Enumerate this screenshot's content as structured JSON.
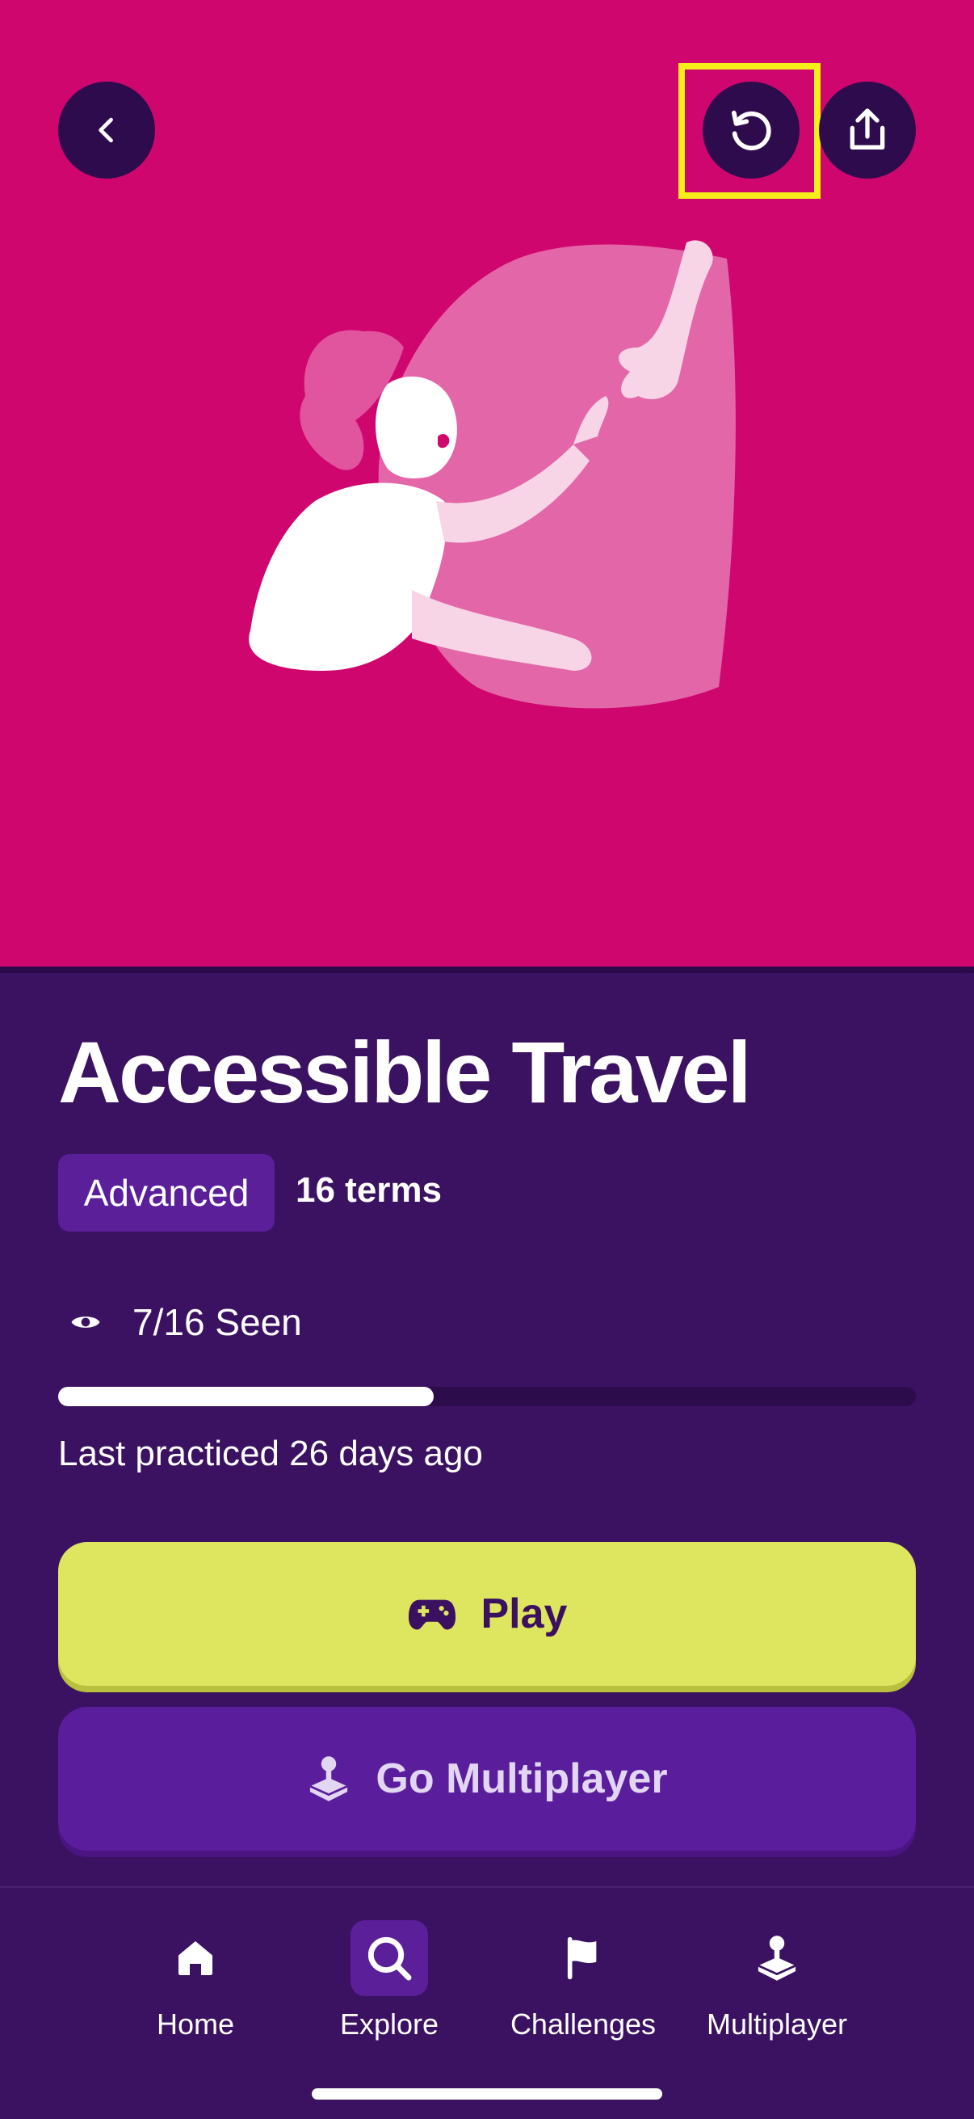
{
  "header": {
    "back_icon": "chevron-left-icon",
    "reset_icon": "reset-icon",
    "share_icon": "share-icon"
  },
  "hero": {
    "background_color": "#d0066f"
  },
  "deck": {
    "title": "Accessible Travel",
    "level": "Advanced",
    "terms": "16 terms",
    "seen_text": "7/16 Seen",
    "seen_fraction": 0.4375,
    "last_practiced": "Last practiced 26 days ago"
  },
  "actions": {
    "play_label": "Play",
    "multiplayer_label": "Go Multiplayer"
  },
  "nav": {
    "items": [
      {
        "label": "Home",
        "icon": "home-icon",
        "active": false
      },
      {
        "label": "Explore",
        "icon": "search-icon",
        "active": true
      },
      {
        "label": "Challenges",
        "icon": "flag-icon",
        "active": false
      },
      {
        "label": "Multiplayer",
        "icon": "joystick-icon",
        "active": false
      }
    ]
  },
  "colors": {
    "panel_bg": "#3b1261",
    "play_button": "#dde65e",
    "multiplayer_button": "#5a1e9c",
    "highlight": "#f5ee1a"
  }
}
